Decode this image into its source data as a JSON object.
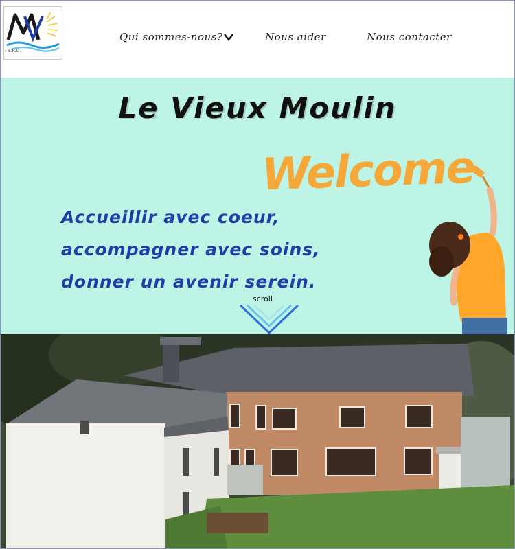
{
  "header": {
    "logo": {
      "letters": "MV",
      "caption": "S.R.G."
    },
    "nav": [
      {
        "label": "Qui sommes-nous?",
        "icon": "chevron-down-icon"
      },
      {
        "label": "Nous aider"
      },
      {
        "label": "Nous contacter"
      }
    ]
  },
  "hero": {
    "title": "Le Vieux Moulin",
    "welcome": "Welcome",
    "tagline": [
      "Accueillir avec coeur,",
      "accompagner avec soins,",
      "donner un avenir serein."
    ],
    "scroll_label": "scroll",
    "colors": {
      "background": "#bdf4e6",
      "tagline": "#1f3ea6",
      "welcome": "#f4a83a"
    }
  }
}
